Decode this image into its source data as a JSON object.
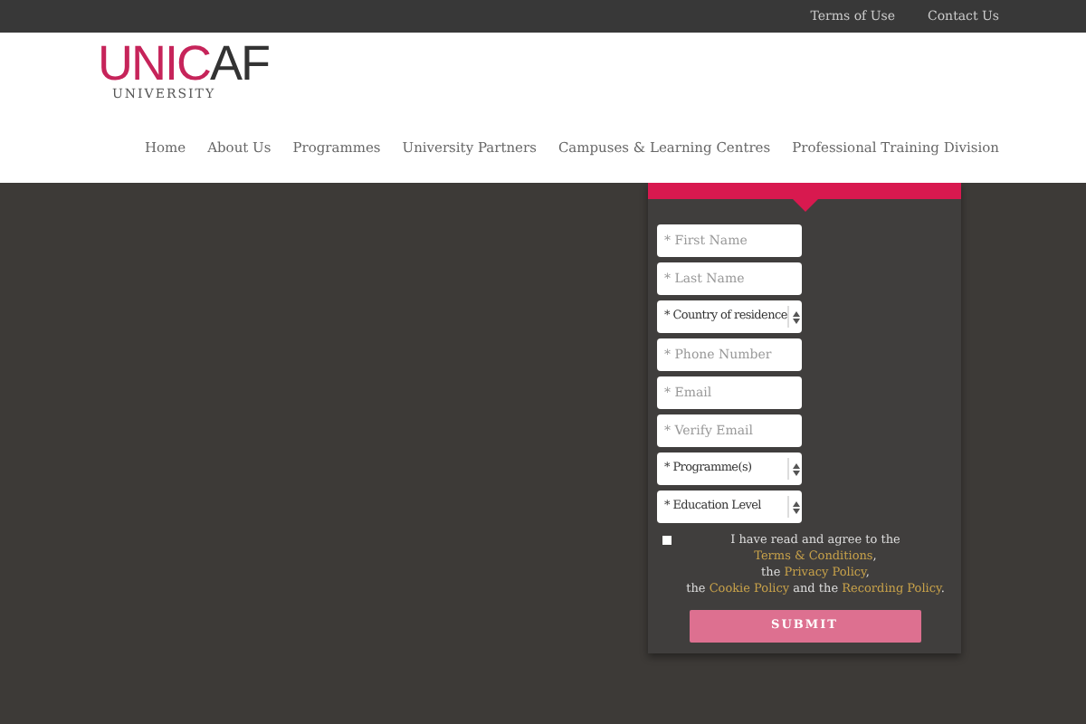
{
  "top_links": [
    "Terms of Use",
    "Contact Us"
  ],
  "logo": {
    "accent": "UNIC",
    "rest": "AF",
    "subtitle": "UNIVERSITY"
  },
  "nav": [
    "Home",
    "About Us",
    "Programmes",
    "University Partners",
    "Campuses & Learning Centres",
    "Professional Training Division"
  ],
  "form": {
    "fields": [
      {
        "kind": "input",
        "placeholder": "* First Name"
      },
      {
        "kind": "input",
        "placeholder": "* Last Name"
      },
      {
        "kind": "select",
        "value": "* Country of residence"
      },
      {
        "kind": "input",
        "placeholder": "* Phone Number"
      },
      {
        "kind": "input",
        "placeholder": "* Email"
      },
      {
        "kind": "input",
        "placeholder": "* Verify Email"
      },
      {
        "kind": "select",
        "value": "* Programme(s)"
      },
      {
        "kind": "select",
        "value": "* Education Level"
      }
    ],
    "consent": {
      "checked": false,
      "lines": [
        [
          {
            "kind": "text",
            "text": "I have read and agree to the "
          },
          {
            "kind": "link",
            "text": "Terms & Conditions"
          },
          {
            "kind": "text",
            "text": ","
          }
        ],
        [
          {
            "kind": "text",
            "text": "the "
          },
          {
            "kind": "link",
            "text": "Privacy Policy"
          },
          {
            "kind": "text",
            "text": ","
          }
        ],
        [
          {
            "kind": "text",
            "text": "the "
          },
          {
            "kind": "link",
            "text": "Cookie Policy"
          },
          {
            "kind": "text",
            "text": " and the "
          },
          {
            "kind": "link",
            "text": "Recording Policy"
          },
          {
            "kind": "text",
            "text": "."
          }
        ]
      ]
    },
    "submit": "SUBMIT"
  }
}
